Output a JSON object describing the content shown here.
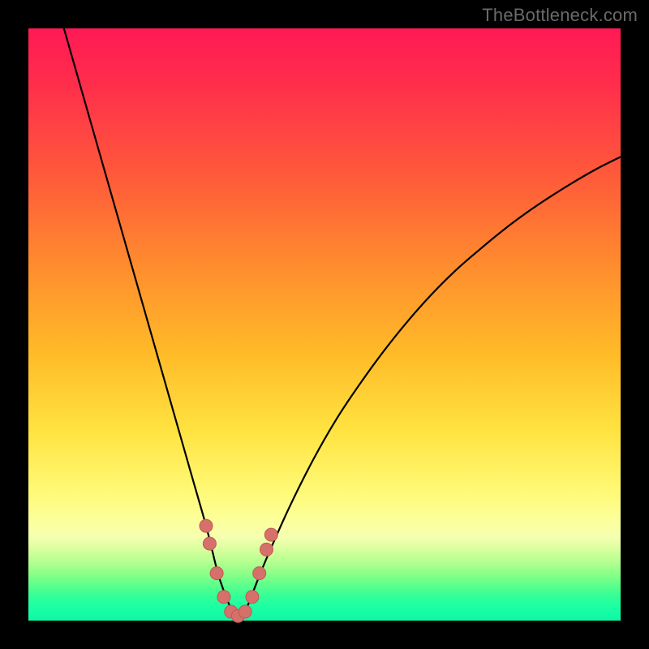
{
  "watermark": "TheBottleneck.com",
  "colors": {
    "frame": "#000000",
    "curve_stroke": "#000000",
    "markers_fill": "#d6706a",
    "markers_stroke": "#c45850"
  },
  "chart_data": {
    "type": "line",
    "title": "",
    "xlabel": "",
    "ylabel": "",
    "xlim": [
      0,
      100
    ],
    "ylim": [
      0,
      100
    ],
    "grid": false,
    "legend": false,
    "series": [
      {
        "name": "bottleneck-curve",
        "style": "line",
        "x": [
          6,
          8,
          10,
          12,
          14,
          16,
          18,
          20,
          22,
          24,
          26,
          28,
          30,
          31,
          32,
          33,
          34,
          35,
          36,
          37,
          38,
          40,
          44,
          48,
          52,
          56,
          60,
          64,
          68,
          72,
          76,
          80,
          84,
          88,
          92,
          96,
          100
        ],
        "y": [
          100,
          93,
          86,
          79,
          72,
          65,
          58,
          51,
          44,
          37,
          30,
          23,
          16,
          12,
          8,
          5,
          2.5,
          1,
          1,
          2.5,
          5,
          10,
          19,
          27,
          34,
          40,
          45.5,
          50.5,
          55,
          59,
          62.5,
          65.8,
          68.8,
          71.5,
          74,
          76.3,
          78.3
        ]
      },
      {
        "name": "markers",
        "style": "scatter",
        "x": [
          30.0,
          30.6,
          31.8,
          33.0,
          34.2,
          35.4,
          36.6,
          37.8,
          39.0,
          40.2,
          41.0
        ],
        "y": [
          16.0,
          13.0,
          8.0,
          4.0,
          1.5,
          0.8,
          1.5,
          4.0,
          8.0,
          12.0,
          14.5
        ]
      }
    ]
  }
}
